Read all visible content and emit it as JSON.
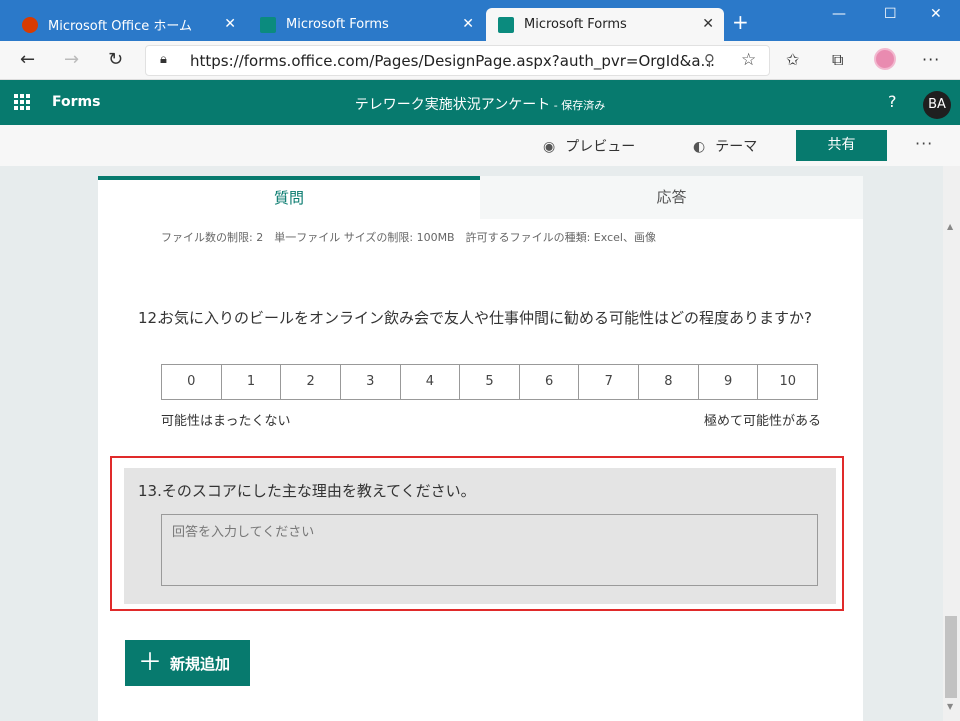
{
  "browser": {
    "tabs": [
      {
        "label": "Microsoft Office ホーム",
        "icon": "office-icon",
        "active": false
      },
      {
        "label": "Microsoft Forms",
        "icon": "forms-icon",
        "active": false
      },
      {
        "label": "Microsoft Forms",
        "icon": "forms-icon",
        "active": true
      }
    ],
    "url": "https://forms.office.com/Pages/DesignPage.aspx?auth_pvr=OrgId&a...",
    "url_host": "forms.office.com"
  },
  "forms_header": {
    "brand": "Forms",
    "title": "テレワーク実施状況アンケート",
    "saved": " - 保存済み",
    "help": "?",
    "avatar_initials": "BA"
  },
  "commands": {
    "preview": "プレビュー",
    "theme": "テーマ",
    "share": "共有",
    "more": "···"
  },
  "tabs": {
    "questions": "質問",
    "responses": "応答"
  },
  "file_info": "ファイル数の制限: 2　単一ファイル サイズの制限: 100MB　許可するファイルの種類: Excel、画像",
  "q12": {
    "number": "12.",
    "text": "お気に入りのビールをオンライン飲み会で友人や仕事仲間に勧める可能性はどの程度ありますか?",
    "scale": [
      "0",
      "1",
      "2",
      "3",
      "4",
      "5",
      "6",
      "7",
      "8",
      "9",
      "10"
    ],
    "low_label": "可能性はまったくない",
    "high_label": "極めて可能性がある"
  },
  "q13": {
    "number": "13.",
    "text": "そのスコアにした主な理由を教えてください。",
    "placeholder": "回答を入力してください"
  },
  "add_new": "新規追加",
  "colors": {
    "brand_teal": "#077a6e",
    "highlight_red": "#e02a2a"
  }
}
